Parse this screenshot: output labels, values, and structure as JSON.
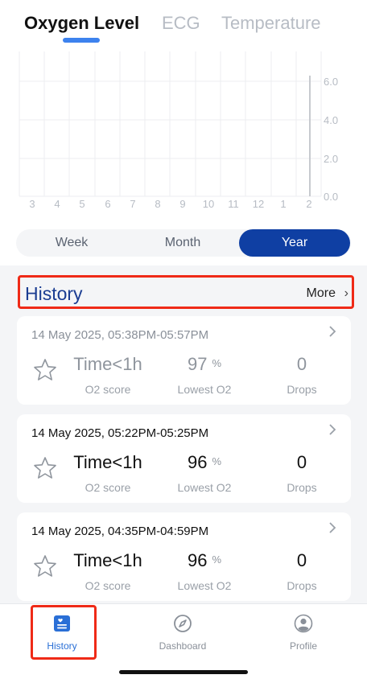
{
  "tabs": [
    {
      "label": "Oxygen Level",
      "active": true
    },
    {
      "label": "ECG",
      "active": false
    },
    {
      "label": "Temperature",
      "active": false
    }
  ],
  "chart": {
    "x_labels": [
      "3",
      "4",
      "5",
      "6",
      "7",
      "8",
      "9",
      "10",
      "11",
      "12",
      "1",
      "2"
    ],
    "y_labels": [
      "6.0",
      "4.0",
      "2.0",
      "0.0"
    ]
  },
  "periods": [
    {
      "label": "Week",
      "active": false
    },
    {
      "label": "Month",
      "active": false
    },
    {
      "label": "Year",
      "active": true
    }
  ],
  "history": {
    "title": "History",
    "more_label": "More",
    "more_chevron": "›"
  },
  "records": [
    {
      "time": "14 May 2025, 05:38PM-05:57PM",
      "score": "Time<1h",
      "score_label": "O2 score",
      "lowest": "97",
      "unit": "%",
      "lowest_label": "Lowest O2",
      "drops": "0",
      "drops_label": "Drops",
      "dim": true
    },
    {
      "time": "14 May 2025, 05:22PM-05:25PM",
      "score": "Time<1h",
      "score_label": "O2 score",
      "lowest": "96",
      "unit": "%",
      "lowest_label": "Lowest O2",
      "drops": "0",
      "drops_label": "Drops",
      "dim": false
    },
    {
      "time": "14 May 2025, 04:35PM-04:59PM",
      "score": "Time<1h",
      "score_label": "O2 score",
      "lowest": "96",
      "unit": "%",
      "lowest_label": "Lowest O2",
      "drops": "0",
      "drops_label": "Drops",
      "dim": false
    }
  ],
  "nav": [
    {
      "label": "History",
      "icon": "history-icon",
      "active": true
    },
    {
      "label": "Dashboard",
      "icon": "compass-icon",
      "active": false
    },
    {
      "label": "Profile",
      "icon": "profile-icon",
      "active": false
    }
  ],
  "colors": {
    "accent": "#0f3fa3",
    "tab_indicator": "#3d82ee",
    "highlight": "#ef2a17",
    "history_title": "#1b3d92",
    "nav_active": "#2a6fd6",
    "nav_inactive": "#8a9099"
  }
}
